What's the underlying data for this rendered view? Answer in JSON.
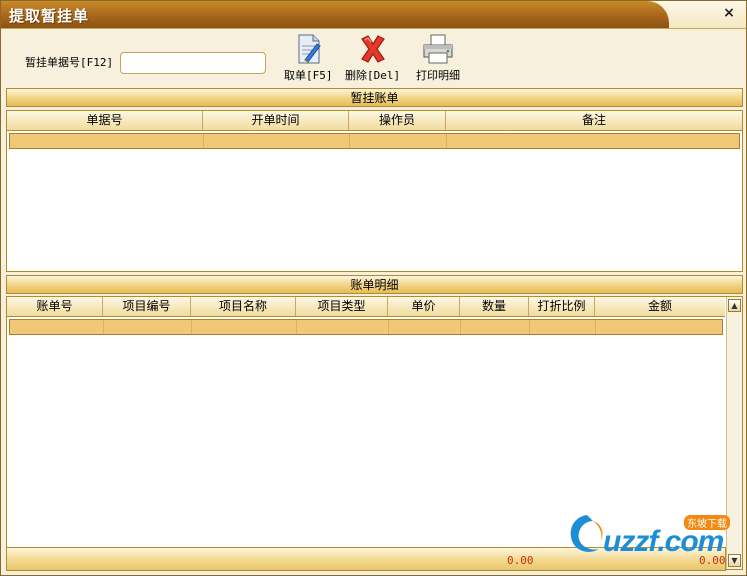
{
  "window": {
    "title": "提取暂挂单",
    "close_glyph": "×"
  },
  "toolbar": {
    "search_label": "暂挂单据号[F12]",
    "search_value": "",
    "fetch_label": "取单[F5]",
    "delete_label": "删除[Del]",
    "print_label": "打印明细"
  },
  "pending": {
    "title": "暂挂账单",
    "columns": [
      "单据号",
      "开单时间",
      "操作员",
      "备注"
    ]
  },
  "detail": {
    "title": "账单明细",
    "columns": [
      "账单号",
      "项目编号",
      "项目名称",
      "项目类型",
      "单价",
      "数量",
      "打折比例",
      "金额"
    ]
  },
  "totals": {
    "left": "0.00",
    "right": "0.00"
  },
  "watermark": {
    "text": "uzzf.com",
    "badge": "东坡下载"
  },
  "colors": {
    "accent": "#b38a2c",
    "title_bg": "#a8661a",
    "row_highlight": "#f0c878",
    "total_text": "#c0301a"
  },
  "icons": {
    "fetch": "document-pen-icon",
    "delete": "red-x-icon",
    "print": "printer-icon"
  }
}
